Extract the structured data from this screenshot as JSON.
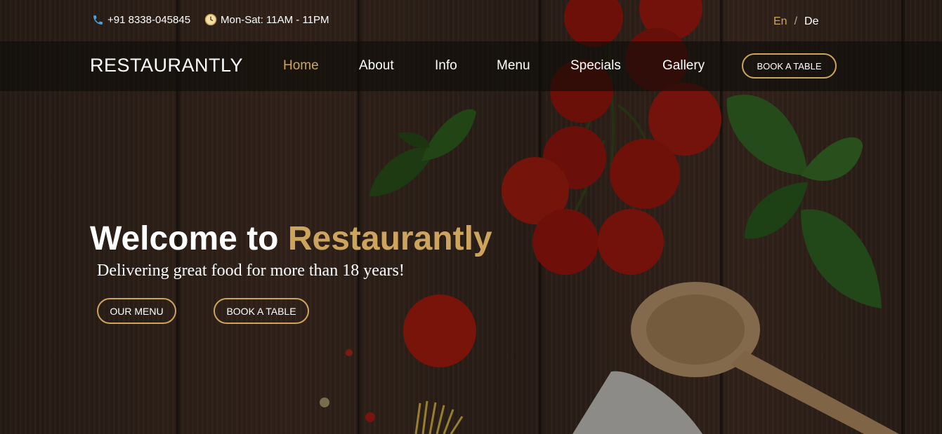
{
  "topbar": {
    "phone": "+91 8338-045845",
    "hours": "Mon-Sat: 11AM - 11PM",
    "phone_icon": "phone-icon",
    "clock_icon": "clock-icon",
    "lang_active": "En",
    "lang_sep": "/",
    "lang_other": "De"
  },
  "navbar": {
    "logo": "RESTAURANTLY",
    "links": [
      "Home",
      "About",
      "Info",
      "Menu",
      "Specials",
      "Gallery"
    ],
    "book_label": "BOOK A TABLE"
  },
  "hero": {
    "title_prefix": "Welcome to ",
    "title_brand": "Restaurantly",
    "subtitle": "Delivering great food for more than 18 years!",
    "menu_button": "OUR MENU",
    "book_button": "BOOK A TABLE"
  },
  "colors": {
    "accent": "#cda45e",
    "text": "#ffffff",
    "nav_bg": "#0c0b09"
  }
}
